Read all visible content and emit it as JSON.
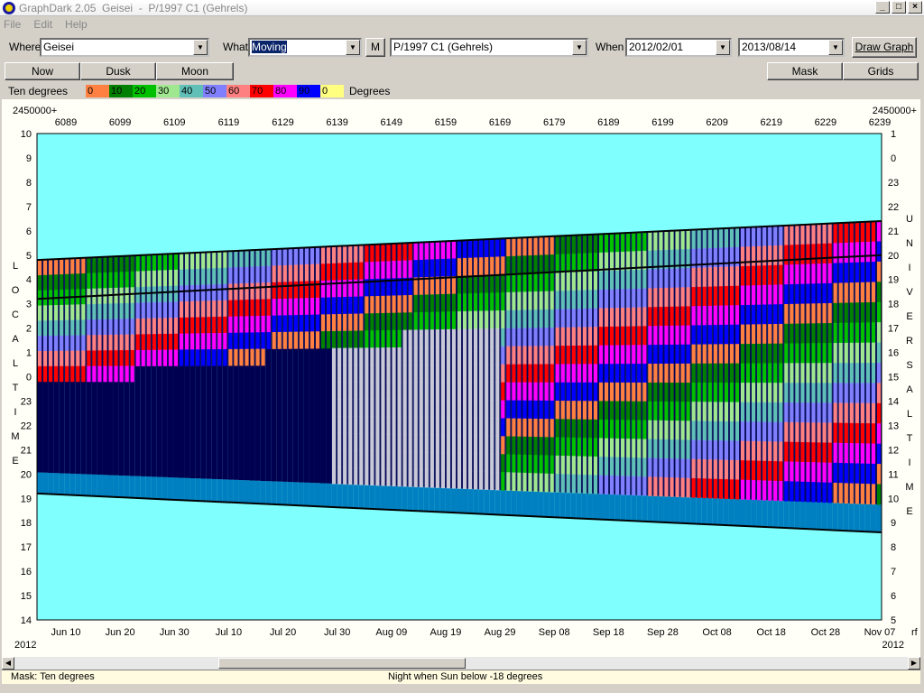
{
  "window": {
    "title": "GraphDark 2.05  Geisei  -  P/1997 C1 (Gehrels)",
    "buttons": [
      "_",
      "□",
      "×"
    ]
  },
  "menu": [
    "File",
    "Edit",
    "Help"
  ],
  "toolbar": {
    "where_label": "Where",
    "where_value": "Geisei",
    "what_label": "What",
    "what_value": "Moving",
    "m_button": "M",
    "object_value": "P/1997 C1 (Gehrels)",
    "when_label": "When",
    "start_date": "2012/02/01",
    "end_date": "2013/08/14",
    "draw_button": "Draw Graph"
  },
  "row2": {
    "now": "Now",
    "dusk": "Dusk",
    "moon": "Moon",
    "mask": "Mask",
    "grids": "Grids"
  },
  "legend": {
    "title": "Ten degrees",
    "unit": "Degrees",
    "entries": [
      {
        "label": "0",
        "color": "#ff8040"
      },
      {
        "label": "10",
        "color": "#008000"
      },
      {
        "label": "20",
        "color": "#00c000"
      },
      {
        "label": "30",
        "color": "#a0e890"
      },
      {
        "label": "40",
        "color": "#60c0b8"
      },
      {
        "label": "50",
        "color": "#8080ff"
      },
      {
        "label": "60",
        "color": "#ff8080"
      },
      {
        "label": "70",
        "color": "#ff0000"
      },
      {
        "label": "80",
        "color": "#ff00ff"
      },
      {
        "label": "90",
        "color": "#0000ff"
      },
      {
        "label": "0",
        "color": "#ffff80"
      }
    ]
  },
  "chart_data": {
    "type": "area",
    "jd_label": "2450000+",
    "jd_ticks": [
      "6089",
      "6099",
      "6109",
      "6119",
      "6129",
      "6139",
      "6149",
      "6159",
      "6169",
      "6179",
      "6189",
      "6199",
      "6209",
      "6219",
      "6229",
      "6239"
    ],
    "date_ticks": [
      "Jun 10",
      "Jun 20",
      "Jun 30",
      "Jul 10",
      "Jul 20",
      "Jul 30",
      "Aug 09",
      "Aug 19",
      "Aug 29",
      "Sep 08",
      "Sep 18",
      "Sep 28",
      "Oct 08",
      "Oct 18",
      "Oct 28",
      "Nov 07"
    ],
    "year_left": "2012",
    "year_right": "2012",
    "right_suffix": "rf",
    "left_axis_title": "LOCAL TIME",
    "left_ticks": [
      "10",
      "9",
      "8",
      "7",
      "6",
      "5",
      "4",
      "3",
      "2",
      "1",
      "0",
      "23",
      "22",
      "21",
      "20",
      "19",
      "18",
      "17",
      "16",
      "15",
      "14"
    ],
    "right_axis_title": "UNIVERSAL TIME",
    "right_ticks": [
      "1",
      "0",
      "23",
      "22",
      "21",
      "20",
      "19",
      "18",
      "17",
      "16",
      "15",
      "14",
      "13",
      "12",
      "11",
      "10",
      "9",
      "8",
      "7",
      "6",
      "5"
    ],
    "colors": {
      "day": "#80ffff",
      "night": "#000050",
      "twilight": "#0080c0",
      "below_horizon": "#c8c8d8"
    },
    "night_band_local_hours": {
      "start": [
        19.2,
        17.6
      ],
      "end": [
        4.8,
        6.4
      ]
    },
    "object_transit_local_hours": [
      3.2,
      5.0
    ]
  },
  "status": {
    "mask": "Mask:  Ten degrees",
    "night": "Night when Sun below -18 degrees"
  }
}
